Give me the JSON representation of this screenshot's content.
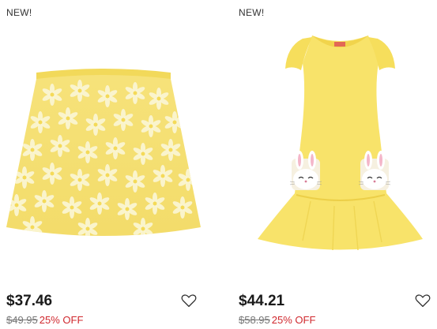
{
  "products": [
    {
      "badge": "NEW!",
      "price": "$37.46",
      "original_price": "$49.95",
      "discount": "25% OFF",
      "image_icon": "yellow-floral-tulle-skirt",
      "wishlist_icon": "heart-outline-icon"
    },
    {
      "badge": "NEW!",
      "price": "$44.21",
      "original_price": "$58.95",
      "discount": "25% OFF",
      "image_icon": "yellow-bunny-pocket-dress",
      "wishlist_icon": "heart-outline-icon"
    }
  ],
  "colors": {
    "discount": "#d0282e",
    "product_yellow": "#f7e36b"
  }
}
